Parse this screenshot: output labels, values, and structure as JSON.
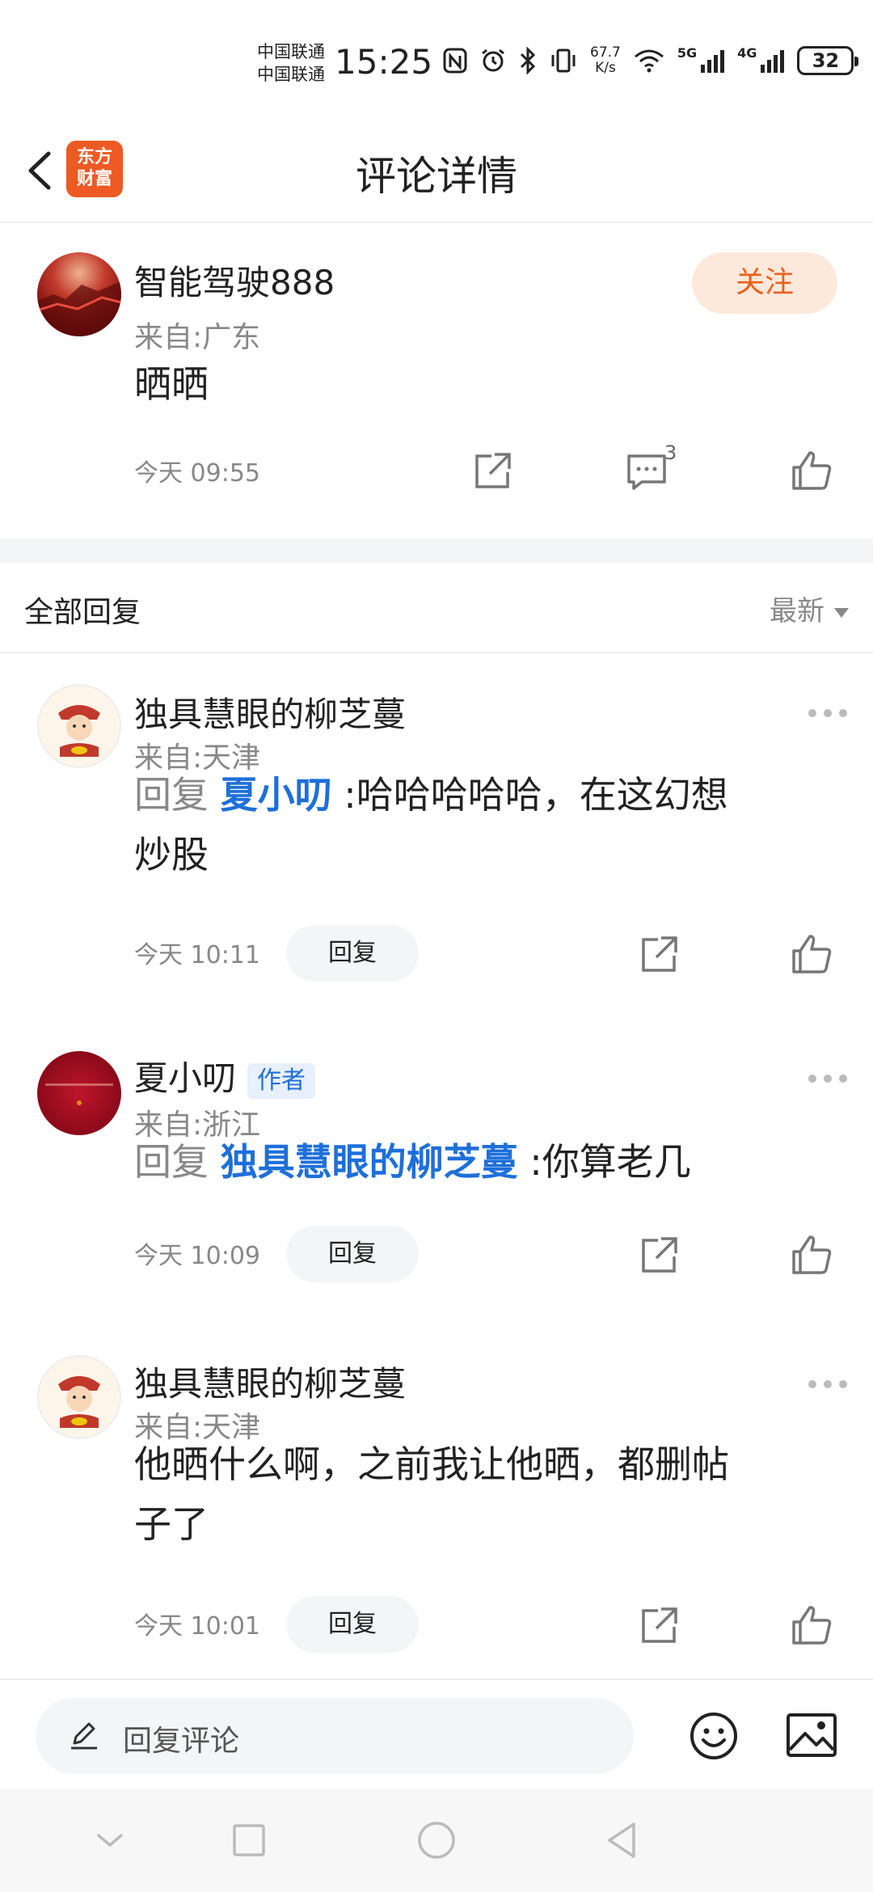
{
  "status_bar": {
    "carrier_1": "中国联通",
    "carrier_2": "中国联通",
    "time": "15:25",
    "net_speed_value": "67.7",
    "net_speed_unit": "K/s",
    "network_1": "5G",
    "network_2": "4G",
    "battery": "32"
  },
  "header": {
    "back_icon": "chevron-left-icon",
    "logo_line_1": "东方",
    "logo_line_2": "财富",
    "title": "评论详情"
  },
  "main_comment": {
    "username": "智能驾驶888",
    "location": "来自:广东",
    "follow_label": "关注",
    "content": "晒晒",
    "time": "今天 09:55",
    "comment_count": "3"
  },
  "replies_header": {
    "label": "全部回复",
    "sort_label": "最新"
  },
  "replies": [
    {
      "username": "独具慧眼的柳芝蔓",
      "location": "来自:天津",
      "prefix": "回复",
      "mention": "夏小叨",
      "separator": ":",
      "text_line_1": "哈哈哈哈哈，在这幻想",
      "text_line_2": "炒股",
      "time": "今天 10:11",
      "reply_label": "回复"
    },
    {
      "username": "夏小叨",
      "author_tag": "作者",
      "location": "来自:浙江",
      "prefix": "回复",
      "mention": "独具慧眼的柳芝蔓",
      "separator": ":",
      "text_line_1": "你算老几",
      "time": "今天 10:09",
      "reply_label": "回复"
    },
    {
      "username": "独具慧眼的柳芝蔓",
      "location": "来自:天津",
      "text_line_1": "他晒什么啊，之前我让他晒，都删帖",
      "text_line_2": "子了",
      "time": "今天 10:01",
      "reply_label": "回复"
    }
  ],
  "bottom_bar": {
    "placeholder": "回复评论"
  },
  "colors": {
    "accent_orange": "#e8621a",
    "follow_bg": "#fde9dc",
    "mention_blue": "#1e6fd9",
    "muted_gray": "#888888"
  }
}
